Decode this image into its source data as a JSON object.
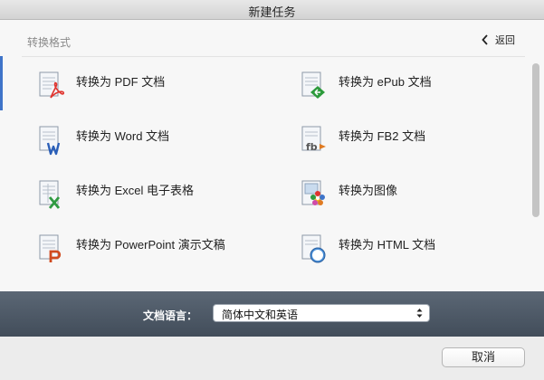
{
  "window": {
    "title": "新建任务"
  },
  "header": {
    "section_title": "转换格式",
    "back_label": "返回"
  },
  "formats": [
    {
      "label": "转换为 PDF 文档",
      "icon": "pdf-icon"
    },
    {
      "label": "转换为 ePub 文档",
      "icon": "epub-icon"
    },
    {
      "label": "转换为 Word 文档",
      "icon": "word-icon"
    },
    {
      "label": "转换为 FB2 文档",
      "icon": "fb2-icon"
    },
    {
      "label": "转换为 Excel 电子表格",
      "icon": "excel-icon"
    },
    {
      "label": "转换为图像",
      "icon": "image-icon"
    },
    {
      "label": "转换为 PowerPoint 演示文稿",
      "icon": "powerpoint-icon"
    },
    {
      "label": "转换为 HTML 文档",
      "icon": "html-icon"
    }
  ],
  "footer": {
    "language_label": "文档语言：",
    "language_value": "简体中文和英语"
  },
  "buttons": {
    "cancel": "取消"
  },
  "colors": {
    "pdf": "#e0342e",
    "epub": "#2c9a3b",
    "word": "#2b5fb8",
    "fb2": "#555555",
    "excel": "#2f9a41",
    "powerpoint": "#d04a1f",
    "accent": "#3f74c9"
  }
}
